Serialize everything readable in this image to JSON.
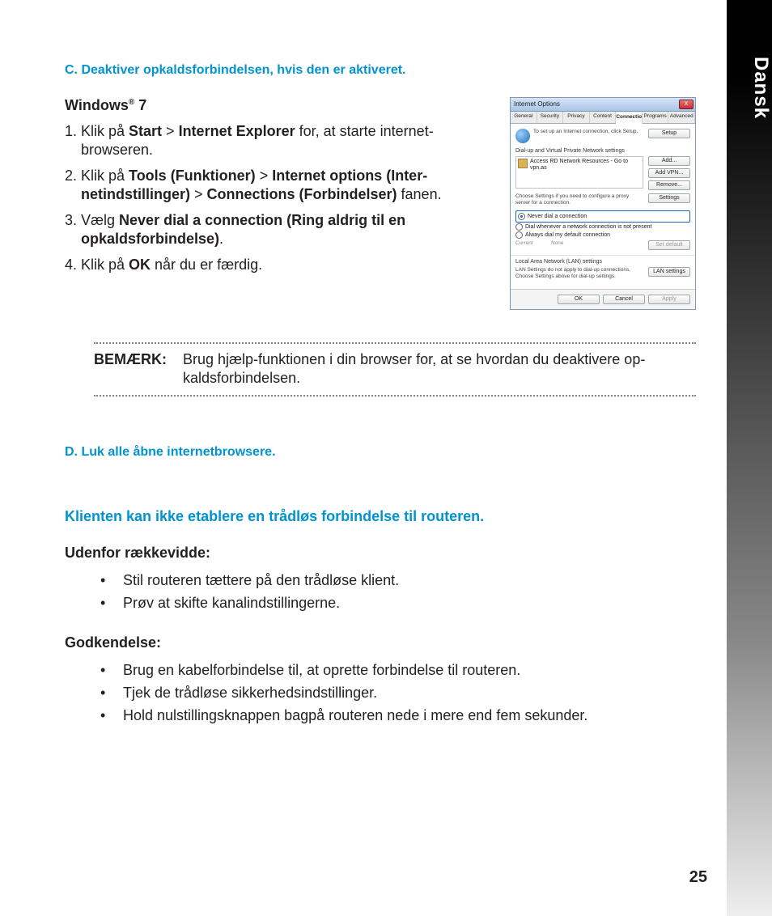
{
  "language_tab": "Dansk",
  "page_number": "25",
  "section_c": "C.   Deaktiver opkaldsforbindelsen, hvis den er aktiveret.",
  "win7_heading": "Windows® 7",
  "steps": {
    "s1_a": "Klik på ",
    "s1_b1": "Start",
    "s1_gt": " > ",
    "s1_b2": "Internet Explorer",
    "s1_c": " for, at starte internet-browseren.",
    "s2_a": "Klik på ",
    "s2_b1": "Tools (Funktioner)",
    "s2_b2": "Internet options (Inter­netindstillinger)",
    "s2_b3": "Connections (Forbindelser)",
    "s2_c": " fanen.",
    "s3_a": "Vælg ",
    "s3_b": "Never dial a connection (Ring aldrig til en opkaldsforbindelse)",
    "s3_c": ".",
    "s4_a": "Klik på ",
    "s4_b": "OK",
    "s4_c": " når du er færdig."
  },
  "note_label": "BEMÆRK:",
  "note_text": "Brug hjælp-funktionen i din browser for, at se hvordan du deaktivere op­kaldsforbindelsen.",
  "section_d": "D.   Luk alle åbne internetbrowsere.",
  "heading_client": "Klienten kan ikke etablere en trådløs forbindelse til routeren.",
  "range_h": "Udenfor rækkevidde:",
  "range_items": [
    "Stil routeren tættere på den trådløse klient.",
    "Prøv at skifte kanalindstillingerne."
  ],
  "auth_h": "Godkendelse:",
  "auth_items": [
    "Brug en kabelforbindelse til, at oprette forbindelse til routeren.",
    "Tjek de trådløse sikkerhedsindstillinger.",
    "Hold nulstillingsknappen bagpå routeren nede i mere end fem sekunder."
  ],
  "dlg": {
    "title": "Internet Options",
    "tabs": [
      "General",
      "Security",
      "Privacy",
      "Content",
      "Connections",
      "Programs",
      "Advanced"
    ],
    "setup_text": "To set up an Internet connection, click Setup.",
    "setup_btn": "Setup",
    "dialup_title": "Dial-up and Virtual Private Network settings",
    "list_item": "Access RD Network Resources - Go to vpn.as",
    "add_btn": "Add...",
    "addvpn_btn": "Add VPN...",
    "remove_btn": "Remove...",
    "proxy_text": "Choose Settings if you need to configure a proxy server for a connection.",
    "settings_btn": "Settings",
    "never": "Never dial a connection",
    "whenever": "Dial whenever a network connection is not present",
    "always": "Always dial my default connection",
    "current": "Current",
    "none": "None",
    "setdefault": "Set default",
    "lan_title": "Local Area Network (LAN) settings",
    "lan_text": "LAN Settings do not apply to dial-up connections. Choose Settings above for dial-up settings.",
    "lan_btn": "LAN settings",
    "ok": "OK",
    "cancel": "Cancel",
    "apply": "Apply",
    "close": "X"
  }
}
